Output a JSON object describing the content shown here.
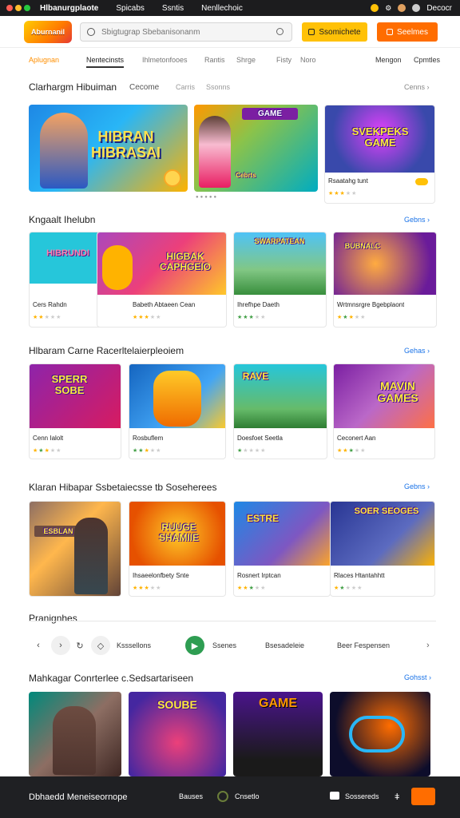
{
  "os_bar": {
    "title": "Hlbanurgplaote",
    "menu": [
      "Spicabs",
      "Ssntis",
      "Nenllechoic"
    ],
    "right_label": "Decocr",
    "colors": {
      "red": "#ff5f56",
      "yellow": "#ffbd2e",
      "green": "#27c93f"
    }
  },
  "header": {
    "logo_text": "Aburnanil",
    "search_placeholder": "Sbigtugrap Sbebanisonanm",
    "btn_primary": "Ssomichete",
    "btn_secondary": "Seelmes",
    "accent_yellow": "#ffc107",
    "accent_orange": "#ff6d00"
  },
  "nav": {
    "brand": "Aplugnan",
    "tabs": [
      "Nentecinsts",
      "Ihlmetonfooes",
      "Rantis",
      "Shrge",
      "Fisty",
      "Noro"
    ],
    "right": [
      "Mengon",
      "Cpmtles"
    ]
  },
  "hero_section": {
    "title": "Clarhargm Hibuiman",
    "tabs": [
      "Cecome",
      "Carris",
      "Ssonns"
    ],
    "see_all": "Cenns",
    "banner_text": [
      "HIBRAN",
      "HIBRASAI"
    ],
    "cards": [
      {
        "img_text": "Cebrts",
        "name": ""
      },
      {
        "img_text": "SVEKPEKS GAME",
        "name": "Rsaatahg tunt",
        "rating": 3
      }
    ],
    "pager": "●●●●●"
  },
  "sections": [
    {
      "title": "Kngaalt Ihelubn",
      "see_all": "Gebns",
      "cards": [
        {
          "img_text": "HIBRUNDI",
          "name": "Cers Rahdn",
          "rating": 2
        },
        {
          "img_text": "HIGBAK CAPHGEIO",
          "name": "Babeth Abtaeen Cean",
          "rating": 3
        },
        {
          "img_text": "SWARPATEAN",
          "name": "Ihrefhpe Daeth",
          "rating": 3
        },
        {
          "img_text": "BUBNALC",
          "name": "Wrtmnsrgre Bgebplaont",
          "rating": 3
        }
      ]
    },
    {
      "title": "Hlbaram  Carne Racerltelaierpleoiem",
      "see_all": "Gehas",
      "cards": [
        {
          "img_text": "SPERR SOBE",
          "name": "Cenn Ialolt",
          "rating": 3
        },
        {
          "img_text": "",
          "name": "Rosbuflem",
          "rating": 3
        },
        {
          "img_text": "RAVE",
          "name": "Doesfoet Seetla",
          "rating": 2
        },
        {
          "img_text": "MAVIN GAMES",
          "name": "Ceconert Aan",
          "rating": 3
        }
      ]
    },
    {
      "title": "Klaran Hibapar  Ssbetaiecsse tb Soseherees",
      "see_all": "Gebns",
      "cards": [
        {
          "img_text": "ESBLAN",
          "name": "",
          "rating": 0
        },
        {
          "img_text": "RUUGE SHAMIIE",
          "name": "Ihsaeelonfbety Snte",
          "rating": 3
        },
        {
          "img_text": "ESTRE",
          "name": "Rosnert Irptcan",
          "rating": 3
        },
        {
          "img_text": "SOER SEOGES",
          "name": "Rlaces Htantahhtt",
          "rating": 2
        }
      ]
    }
  ],
  "filters": {
    "title": "Pranignhes",
    "items": [
      "Ksssellons",
      "Ssenes",
      "Bsesadeleie",
      "Beer Fespensen"
    ]
  },
  "last_section": {
    "title": "Mahkagar  Conrterlee c.Sedsartariseen",
    "see_all": "Gohsst",
    "cards": [
      {
        "img_text": ""
      },
      {
        "img_text": "SOUBE"
      },
      {
        "img_text": "GAME"
      },
      {
        "img_text": ""
      }
    ]
  },
  "bottom_bar": {
    "title": "Dbhaedd Meneiseornope",
    "items": [
      "Bauses",
      "Cnsetlo",
      "Sossereds"
    ]
  }
}
